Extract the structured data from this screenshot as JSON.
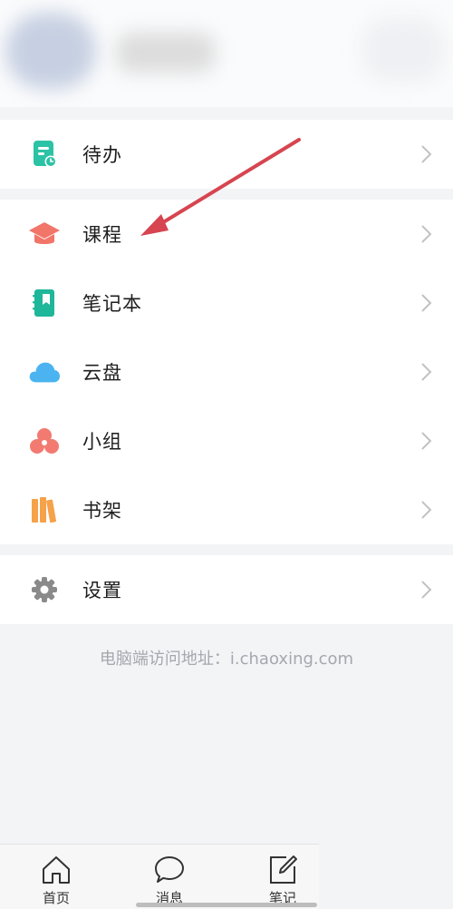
{
  "menu": {
    "todo": "待办",
    "course": "课程",
    "notebook": "笔记本",
    "cloud": "云盘",
    "group": "小组",
    "bookshelf": "书架",
    "settings": "设置"
  },
  "footer": {
    "pc_access": "电脑端访问地址：i.chaoxing.com"
  },
  "tabbar": {
    "home": "首页",
    "messages": "消息",
    "notes": "笔记"
  },
  "colors": {
    "todo_icon": "#2cc2a5",
    "course_icon": "#f2756a",
    "notebook_icon": "#1fb79a",
    "cloud_icon": "#4bb4f0",
    "group_icon": "#f27a70",
    "bookshelf_icon": "#f5a24a",
    "settings_icon": "#8a8a8a",
    "annotation_arrow": "#d64550"
  }
}
